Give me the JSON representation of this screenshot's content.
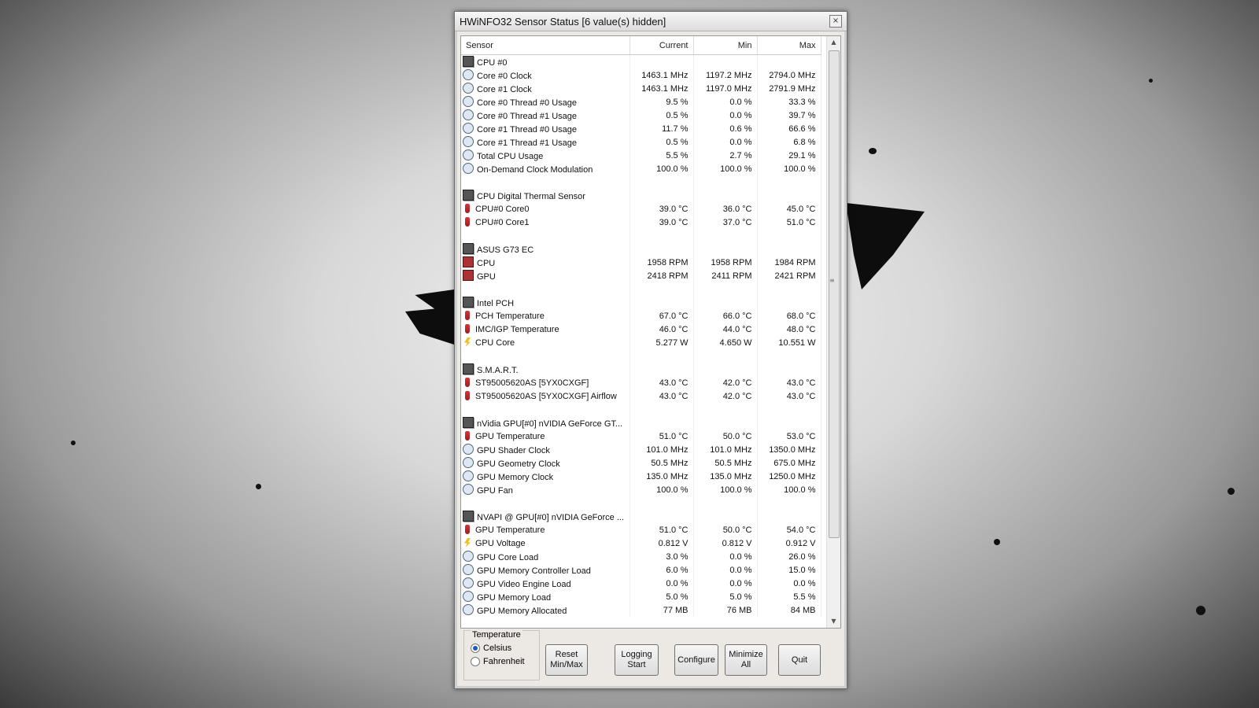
{
  "window": {
    "title": "HWiNFO32 Sensor Status [6 value(s) hidden]"
  },
  "columns": [
    "Sensor",
    "Current",
    "Min",
    "Max"
  ],
  "rows": [
    {
      "type": "group",
      "icon": "chip-icon",
      "name": "CPU #0"
    },
    {
      "type": "row",
      "icon": "clock-icon",
      "name": "Core #0 Clock",
      "current": "1463.1 MHz",
      "min": "1197.2 MHz",
      "max": "2794.0 MHz"
    },
    {
      "type": "row",
      "icon": "clock-icon",
      "name": "Core #1 Clock",
      "current": "1463.1 MHz",
      "min": "1197.0 MHz",
      "max": "2791.9 MHz"
    },
    {
      "type": "row",
      "icon": "clock-icon",
      "name": "Core #0 Thread #0 Usage",
      "current": "9.5 %",
      "min": "0.0 %",
      "max": "33.3 %"
    },
    {
      "type": "row",
      "icon": "clock-icon",
      "name": "Core #0 Thread #1 Usage",
      "current": "0.5 %",
      "min": "0.0 %",
      "max": "39.7 %"
    },
    {
      "type": "row",
      "icon": "clock-icon",
      "name": "Core #1 Thread #0 Usage",
      "current": "11.7 %",
      "min": "0.6 %",
      "max": "66.6 %"
    },
    {
      "type": "row",
      "icon": "clock-icon",
      "name": "Core #1 Thread #1 Usage",
      "current": "0.5 %",
      "min": "0.0 %",
      "max": "6.8 %"
    },
    {
      "type": "row",
      "icon": "clock-icon",
      "name": "Total CPU Usage",
      "current": "5.5 %",
      "min": "2.7 %",
      "max": "29.1 %"
    },
    {
      "type": "row",
      "icon": "clock-icon",
      "name": "On-Demand Clock Modulation",
      "current": "100.0 %",
      "min": "100.0 %",
      "max": "100.0 %"
    },
    {
      "type": "blank"
    },
    {
      "type": "group",
      "icon": "chip-icon",
      "name": "CPU Digital Thermal Sensor"
    },
    {
      "type": "row",
      "icon": "thermometer-icon",
      "name": "CPU#0 Core0",
      "current": "39.0 °C",
      "min": "36.0 °C",
      "max": "45.0 °C"
    },
    {
      "type": "row",
      "icon": "thermometer-icon",
      "name": "CPU#0 Core1",
      "current": "39.0 °C",
      "min": "37.0 °C",
      "max": "51.0 °C"
    },
    {
      "type": "blank"
    },
    {
      "type": "group",
      "icon": "chip-icon",
      "name": "ASUS G73 EC"
    },
    {
      "type": "row",
      "icon": "fan-icon",
      "name": "CPU",
      "current": "1958 RPM",
      "min": "1958 RPM",
      "max": "1984 RPM"
    },
    {
      "type": "row",
      "icon": "fan-icon",
      "name": "GPU",
      "current": "2418 RPM",
      "min": "2411 RPM",
      "max": "2421 RPM"
    },
    {
      "type": "blank"
    },
    {
      "type": "group",
      "icon": "chip-icon",
      "name": "Intel PCH"
    },
    {
      "type": "row",
      "icon": "thermometer-icon",
      "name": "PCH Temperature",
      "current": "67.0 °C",
      "min": "66.0 °C",
      "max": "68.0 °C"
    },
    {
      "type": "row",
      "icon": "thermometer-icon",
      "name": "IMC/IGP Temperature",
      "current": "46.0 °C",
      "min": "44.0 °C",
      "max": "48.0 °C"
    },
    {
      "type": "row",
      "icon": "lightning-icon",
      "name": "CPU Core",
      "current": "5.277 W",
      "min": "4.650 W",
      "max": "10.551 W"
    },
    {
      "type": "blank"
    },
    {
      "type": "group",
      "icon": "chip-icon",
      "name": "S.M.A.R.T."
    },
    {
      "type": "row",
      "icon": "thermometer-icon",
      "name": "ST95005620AS [5YX0CXGF]",
      "current": "43.0 °C",
      "min": "42.0 °C",
      "max": "43.0 °C"
    },
    {
      "type": "row",
      "icon": "thermometer-icon",
      "name": "ST95005620AS [5YX0CXGF] Airflow",
      "current": "43.0 °C",
      "min": "42.0 °C",
      "max": "43.0 °C"
    },
    {
      "type": "blank"
    },
    {
      "type": "group",
      "icon": "chip-icon",
      "name": "nVidia GPU[#0] nVIDIA GeForce GT..."
    },
    {
      "type": "row",
      "icon": "thermometer-icon",
      "name": "GPU Temperature",
      "current": "51.0 °C",
      "min": "50.0 °C",
      "max": "53.0 °C"
    },
    {
      "type": "row",
      "icon": "clock-icon",
      "name": "GPU Shader Clock",
      "current": "101.0 MHz",
      "min": "101.0 MHz",
      "max": "1350.0 MHz"
    },
    {
      "type": "row",
      "icon": "clock-icon",
      "name": "GPU Geometry Clock",
      "current": "50.5 MHz",
      "min": "50.5 MHz",
      "max": "675.0 MHz"
    },
    {
      "type": "row",
      "icon": "clock-icon",
      "name": "GPU Memory Clock",
      "current": "135.0 MHz",
      "min": "135.0 MHz",
      "max": "1250.0 MHz"
    },
    {
      "type": "row",
      "icon": "clock-icon",
      "name": "GPU Fan",
      "current": "100.0 %",
      "min": "100.0 %",
      "max": "100.0 %"
    },
    {
      "type": "blank"
    },
    {
      "type": "group",
      "icon": "chip-icon",
      "name": "NVAPI @ GPU[#0] nVIDIA GeForce ..."
    },
    {
      "type": "row",
      "icon": "thermometer-icon",
      "name": "GPU Temperature",
      "current": "51.0 °C",
      "min": "50.0 °C",
      "max": "54.0 °C"
    },
    {
      "type": "row",
      "icon": "lightning-icon",
      "name": "GPU Voltage",
      "current": "0.812 V",
      "min": "0.812 V",
      "max": "0.912 V"
    },
    {
      "type": "row",
      "icon": "clock-icon",
      "name": "GPU Core Load",
      "current": "3.0 %",
      "min": "0.0 %",
      "max": "26.0 %"
    },
    {
      "type": "row",
      "icon": "clock-icon",
      "name": "GPU Memory Controller Load",
      "current": "6.0 %",
      "min": "0.0 %",
      "max": "15.0 %"
    },
    {
      "type": "row",
      "icon": "clock-icon",
      "name": "GPU Video Engine Load",
      "current": "0.0 %",
      "min": "0.0 %",
      "max": "0.0 %"
    },
    {
      "type": "row",
      "icon": "clock-icon",
      "name": "GPU Memory Load",
      "current": "5.0 %",
      "min": "5.0 %",
      "max": "5.5 %"
    },
    {
      "type": "row",
      "icon": "clock-icon",
      "name": "GPU Memory Allocated",
      "current": "77 MB",
      "min": "76 MB",
      "max": "84 MB"
    }
  ],
  "temperature": {
    "label": "Temperature",
    "options": [
      "Celsius",
      "Fahrenheit"
    ],
    "selected": "Celsius"
  },
  "buttons": {
    "reset": "Reset Min/Max",
    "logging": "Logging Start",
    "configure": "Configure",
    "minimize": "Minimize All",
    "quit": "Quit"
  },
  "close_glyph": "×"
}
